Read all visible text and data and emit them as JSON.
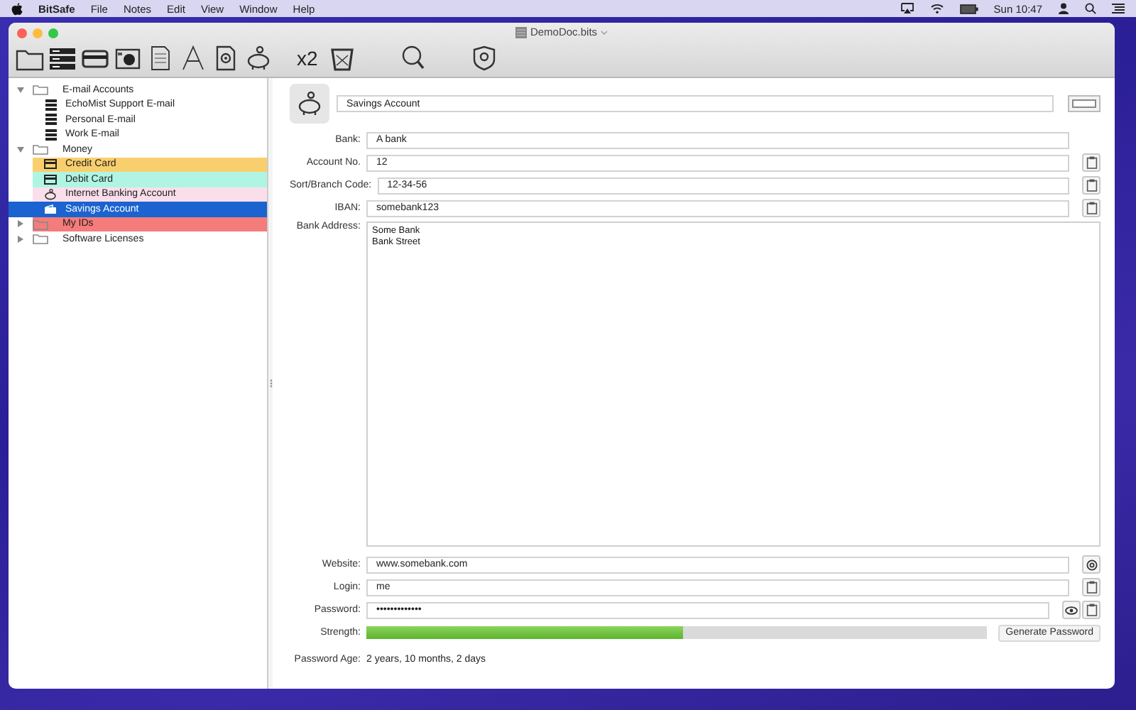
{
  "menubar": {
    "app": "BitSafe",
    "menus": [
      "File",
      "Notes",
      "Edit",
      "View",
      "Window",
      "Help"
    ],
    "clock": "Sun 10:47"
  },
  "window": {
    "title": "DemoDoc.bits"
  },
  "toolbar": {
    "label": "x2"
  },
  "sidebar": {
    "items": [
      {
        "label": "E-mail Accounts",
        "kind": "group",
        "expanded": true,
        "selected": false,
        "children": [
          {
            "label": "EchoMist Support E-mail",
            "kind": "email",
            "selected": false
          },
          {
            "label": "Personal E-mail",
            "kind": "email",
            "selected": false
          },
          {
            "label": "Work E-mail",
            "kind": "email",
            "selected": false
          }
        ]
      },
      {
        "label": "Money",
        "kind": "group",
        "expanded": true,
        "selected": false,
        "children": [
          {
            "label": "Credit Card",
            "kind": "card",
            "selected": false,
            "color": "#f9cf6e"
          },
          {
            "label": "Debit Card",
            "kind": "card",
            "selected": false,
            "color": "#b0f5e3"
          },
          {
            "label": "Internet Banking Account",
            "kind": "bank",
            "selected": false,
            "color": "#fadfeb"
          },
          {
            "label": "Savings Account",
            "kind": "savings",
            "selected": true
          }
        ]
      },
      {
        "label": "My IDs",
        "kind": "group",
        "expanded": false,
        "selected": false,
        "color": "#f47c7a"
      },
      {
        "label": "Software Licenses",
        "kind": "group",
        "expanded": false,
        "selected": false
      }
    ]
  },
  "form": {
    "title": "Savings Account",
    "fields": [
      {
        "kind": "text",
        "label": "Bank:",
        "value": "A bank"
      },
      {
        "kind": "text",
        "label": "Account No.",
        "value": "12",
        "actions": [
          {
            "kind": "copy"
          }
        ]
      },
      {
        "kind": "text",
        "label": "Sort/Branch Code:",
        "value": "12-34-56",
        "actions": [
          {
            "kind": "copy"
          }
        ]
      },
      {
        "kind": "text",
        "label": "IBAN:",
        "value": "somebank123",
        "actions": [
          {
            "kind": "copy"
          }
        ]
      },
      {
        "kind": "area",
        "label": "Bank Address:",
        "value": "Some Bank\nBank Street"
      },
      {
        "kind": "text",
        "label": "Website:",
        "value": "www.somebank.com",
        "actions": [
          {
            "kind": "email"
          }
        ]
      },
      {
        "kind": "text",
        "label": "Login:",
        "value": "me",
        "actions": [
          {
            "kind": "copy"
          }
        ]
      },
      {
        "kind": "password",
        "label": "Password:",
        "value": "•••••••••••••",
        "actions": [
          {
            "kind": "reveal"
          },
          {
            "kind": "copy"
          }
        ]
      },
      {
        "kind": "strength",
        "label": "Strength:",
        "level": 0.51,
        "button": "Generate Password"
      },
      {
        "kind": "info",
        "label": "Password Age:",
        "value": "2 years, 10 months, 2 days"
      }
    ]
  }
}
